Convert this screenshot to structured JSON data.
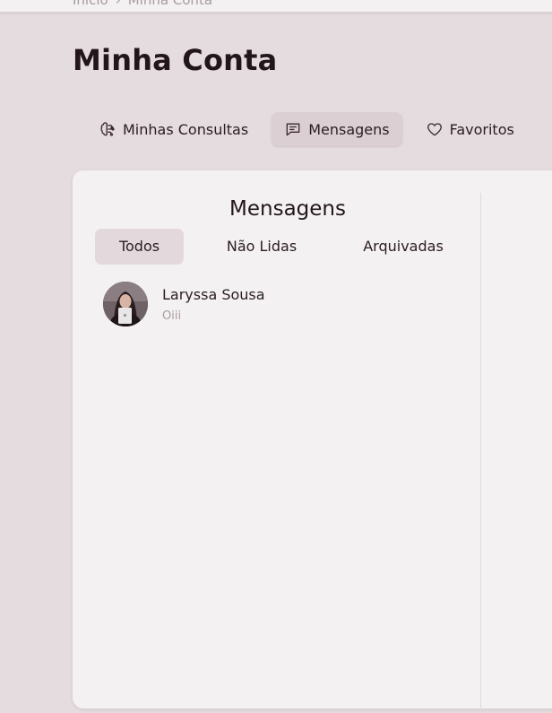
{
  "breadcrumb": {
    "home": "Início",
    "separator": "›",
    "current": "Minha Conta"
  },
  "page": {
    "title": "Minha Conta"
  },
  "nav": {
    "items": [
      {
        "label": "Minhas Consultas",
        "icon": "brain-icon",
        "active": false
      },
      {
        "label": "Mensagens",
        "icon": "message-icon",
        "active": true
      },
      {
        "label": "Favoritos",
        "icon": "heart-icon",
        "active": false
      }
    ]
  },
  "messages": {
    "title": "Mensagens",
    "filters": [
      {
        "label": "Todos",
        "active": true
      },
      {
        "label": "Não Lidas",
        "active": false
      },
      {
        "label": "Arquivadas",
        "active": false
      }
    ],
    "conversations": [
      {
        "name": "Laryssa Sousa",
        "preview": "Oiii",
        "avatar": "avatar-photo"
      }
    ]
  },
  "colors": {
    "background": "#e5dcdf",
    "card": "#f4f1f2",
    "active_tab": "#dccfd4",
    "text": "#2b1d22",
    "muted_text": "#a99da2"
  }
}
